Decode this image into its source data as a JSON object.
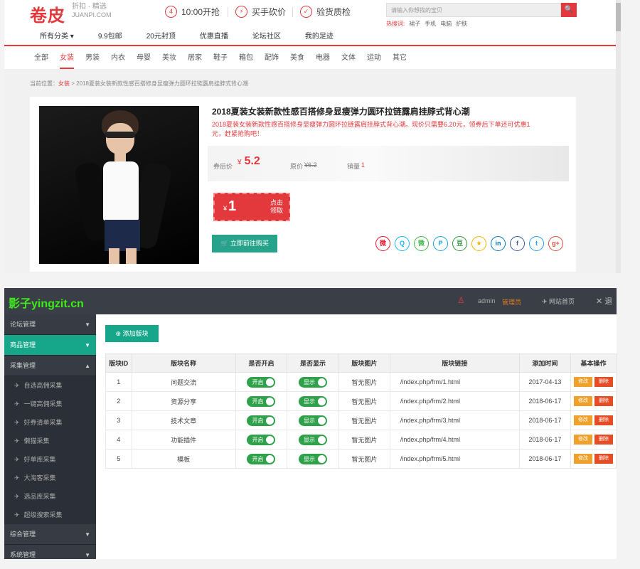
{
  "shop": {
    "logo": "卷皮",
    "logo_sub1": "折扣 · 精选",
    "logo_sub2": "JUANPI.COM",
    "promos": [
      {
        "icon": "4",
        "label": "10:00开抢"
      },
      {
        "icon": "⚡",
        "label": "买手砍价"
      },
      {
        "icon": "✓",
        "label": "验货质检"
      }
    ],
    "search_placeholder": "请输入你想找的宝贝",
    "search_icon": "🔍",
    "hot_label": "热搜词:",
    "hot_words": [
      "裙子",
      "手机",
      "电脑",
      "护肤"
    ],
    "nav_main": [
      "所有分类 ▾",
      "9.9包邮",
      "20元封顶",
      "优惠直播",
      "论坛社区",
      "我的足迹"
    ],
    "nav_cats": [
      "全部",
      "女装",
      "男装",
      "内衣",
      "母婴",
      "美妆",
      "居家",
      "鞋子",
      "箱包",
      "配饰",
      "美食",
      "电器",
      "文体",
      "运动",
      "其它"
    ],
    "active_cat": "女装",
    "breadcrumb": [
      "当前位置：",
      "女装",
      " > 2018夏装女装新款性感百搭修身显瘦弹力圆环拉链露肩挂脖式背心潮"
    ],
    "product": {
      "title": "2018夏装女装新款性感百搭修身显瘦弹力圆环拉链露肩挂脖式背心潮",
      "desc": "2018夏装女装新款性感百搭修身显瘦弹力圆环拉链露肩挂脖式背心潮。现价只需要6.20元，领券后下单还可优惠1元，赶紧抢购吧！",
      "coupon_price_label": "券后价",
      "currency": "¥",
      "coupon_price": "5.2",
      "orig_label": "原价",
      "orig_price": "¥6.2",
      "sales_label": "销量",
      "sales": "1",
      "coupon_amount": "1",
      "coupon_action": "点击领取",
      "buy_label": "立即前往购买"
    },
    "share_icons": [
      {
        "name": "weibo-icon",
        "glyph": "微",
        "color": "#e6162d"
      },
      {
        "name": "qq-icon",
        "glyph": "Q",
        "color": "#12b7f5"
      },
      {
        "name": "wechat-icon",
        "glyph": "微",
        "color": "#44b549"
      },
      {
        "name": "pinterest-icon",
        "glyph": "P",
        "color": "#1aa3e0"
      },
      {
        "name": "douban-icon",
        "glyph": "豆",
        "color": "#2e963d"
      },
      {
        "name": "star-icon",
        "glyph": "★",
        "color": "#f5b400"
      },
      {
        "name": "linkedin-icon",
        "glyph": "in",
        "color": "#0077b5"
      },
      {
        "name": "facebook-icon",
        "glyph": "f",
        "color": "#3b5998"
      },
      {
        "name": "twitter-icon",
        "glyph": "t",
        "color": "#1da1f2"
      },
      {
        "name": "googleplus-icon",
        "glyph": "g+",
        "color": "#dd4b39"
      }
    ]
  },
  "admin": {
    "logo": "影子yingzit.cn",
    "user_icon": "♙",
    "user_name": "admin",
    "user_role": "管理员",
    "home_link": "网站首页",
    "exit_label": "✕ 退",
    "sidebar": [
      {
        "label": "论坛管理",
        "type": "group",
        "arrow": "▼"
      },
      {
        "label": "商品管理",
        "type": "active",
        "arrow": "▼"
      },
      {
        "label": "采集管理",
        "type": "group",
        "arrow": "▲"
      },
      {
        "label": "自选高佣采集",
        "type": "sub"
      },
      {
        "label": "一键高佣采集",
        "type": "sub"
      },
      {
        "label": "好券清单采集",
        "type": "sub"
      },
      {
        "label": "懒猫采集",
        "type": "sub"
      },
      {
        "label": "好单库采集",
        "type": "sub"
      },
      {
        "label": "大淘客采集",
        "type": "sub"
      },
      {
        "label": "选品库采集",
        "type": "sub"
      },
      {
        "label": "超级搜索采集",
        "type": "sub"
      },
      {
        "label": "综合管理",
        "type": "group",
        "arrow": "▼"
      },
      {
        "label": "系统管理",
        "type": "group",
        "arrow": "▼"
      }
    ],
    "add_button": "⊕ 添加版块",
    "columns": [
      "版块ID",
      "版块名称",
      "是否开启",
      "是否显示",
      "版块图片",
      "版块链接",
      "添加时间",
      "基本操作"
    ],
    "rows": [
      {
        "id": "1",
        "name": "问题交流",
        "open": "开启",
        "show": "显示",
        "img": "暂无图片",
        "link": "/index.php/frm/1.html",
        "time": "2017-04-13",
        "edit": "修改",
        "del": "删除"
      },
      {
        "id": "2",
        "name": "资源分享",
        "open": "开启",
        "show": "显示",
        "img": "暂无图片",
        "link": "/index.php/frm/2.html",
        "time": "2018-06-17",
        "edit": "修改",
        "del": "删除"
      },
      {
        "id": "3",
        "name": "技术文章",
        "open": "开启",
        "show": "显示",
        "img": "暂无图片",
        "link": "/index.php/frm/3.html",
        "time": "2018-06-17",
        "edit": "修改",
        "del": "删除"
      },
      {
        "id": "4",
        "name": "功能插件",
        "open": "开启",
        "show": "显示",
        "img": "暂无图片",
        "link": "/index.php/frm/4.html",
        "time": "2018-06-17",
        "edit": "修改",
        "del": "删除"
      },
      {
        "id": "5",
        "name": "模板",
        "open": "开启",
        "show": "显示",
        "img": "暂无图片",
        "link": "/index.php/frm/5.html",
        "time": "2018-06-17",
        "edit": "修改",
        "del": "删除"
      }
    ]
  }
}
